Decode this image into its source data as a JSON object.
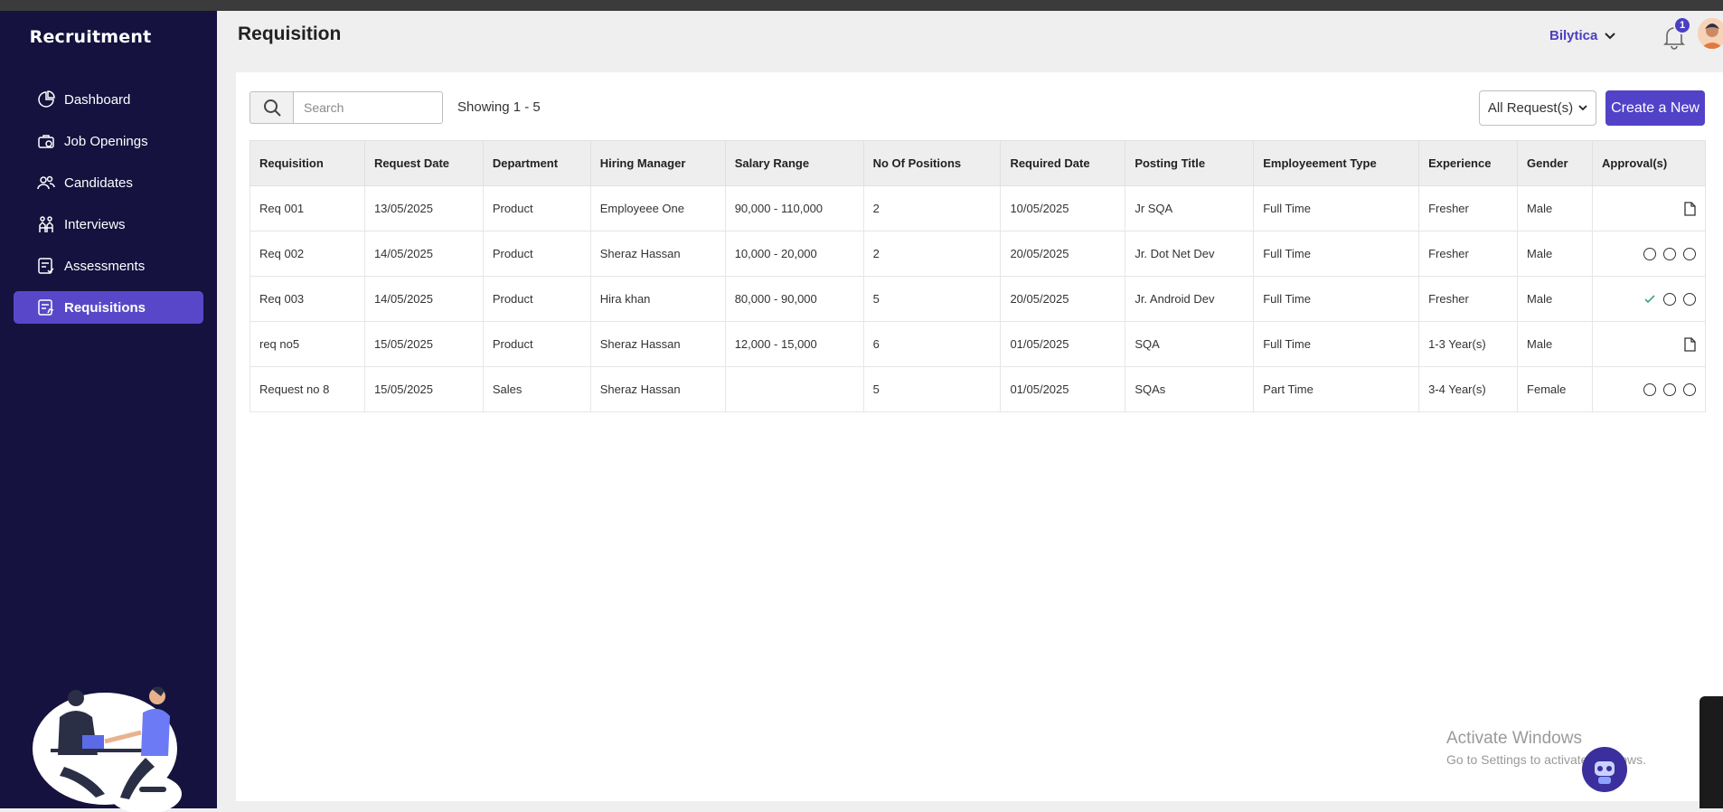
{
  "sidebar": {
    "brand": "Recruitment",
    "items": [
      {
        "label": "Dashboard",
        "icon": "pie-chart-icon"
      },
      {
        "label": "Job Openings",
        "icon": "briefcase-icon"
      },
      {
        "label": "Candidates",
        "icon": "users-icon"
      },
      {
        "label": "Interviews",
        "icon": "interview-icon"
      },
      {
        "label": "Assessments",
        "icon": "assessment-icon"
      },
      {
        "label": "Requisitions",
        "icon": "requisition-icon",
        "active": true
      }
    ]
  },
  "header": {
    "title": "Requisition",
    "org": "Bilytica",
    "notification_count": "1"
  },
  "toolbar": {
    "search_placeholder": "Search",
    "showing": "Showing 1 - 5",
    "filter_label": "All Request(s)",
    "create_label": "Create a New"
  },
  "table": {
    "columns": [
      "Requisition",
      "Request Date",
      "Department",
      "Hiring Manager",
      "Salary Range",
      "No Of Positions",
      "Required Date",
      "Posting Title",
      "Employeement Type",
      "Experience",
      "Gender",
      "Approval(s)"
    ],
    "rows": [
      {
        "cells": [
          "Req 001",
          "13/05/2025",
          "Product",
          "Employeee One",
          "90,000 - 110,000",
          "2",
          "10/05/2025",
          "Jr SQA",
          "Full Time",
          "Fresher",
          "Male"
        ],
        "approval": [
          "doc"
        ]
      },
      {
        "cells": [
          "Req 002",
          "14/05/2025",
          "Product",
          "Sheraz Hassan",
          "10,000 - 20,000",
          "2",
          "20/05/2025",
          "Jr. Dot Net Dev",
          "Full Time",
          "Fresher",
          "Male"
        ],
        "approval": [
          "circle",
          "circle",
          "circle"
        ]
      },
      {
        "cells": [
          "Req 003",
          "14/05/2025",
          "Product",
          "Hira khan",
          "80,000 - 90,000",
          "5",
          "20/05/2025",
          "Jr. Android Dev",
          "Full Time",
          "Fresher",
          "Male"
        ],
        "approval": [
          "check",
          "circle",
          "circle"
        ]
      },
      {
        "cells": [
          "req no5",
          "15/05/2025",
          "Product",
          "Sheraz Hassan",
          "12,000 - 15,000",
          "6",
          "01/05/2025",
          "SQA",
          "Full Time",
          "1-3 Year(s)",
          "Male"
        ],
        "approval": [
          "doc"
        ]
      },
      {
        "cells": [
          "Request no 8",
          "15/05/2025",
          "Sales",
          "Sheraz Hassan",
          "",
          "5",
          "01/05/2025",
          "SQAs",
          "Part Time",
          "3-4 Year(s)",
          "Female"
        ],
        "approval": [
          "circle",
          "circle",
          "circle"
        ]
      }
    ]
  },
  "watermark": {
    "line1": "Activate Windows",
    "line2": "Go to Settings to activate Windows."
  },
  "colors": {
    "sidebar_bg": "#15123f",
    "accent": "#5242c8",
    "active_item": "#5848c9",
    "check": "#3aa776"
  }
}
